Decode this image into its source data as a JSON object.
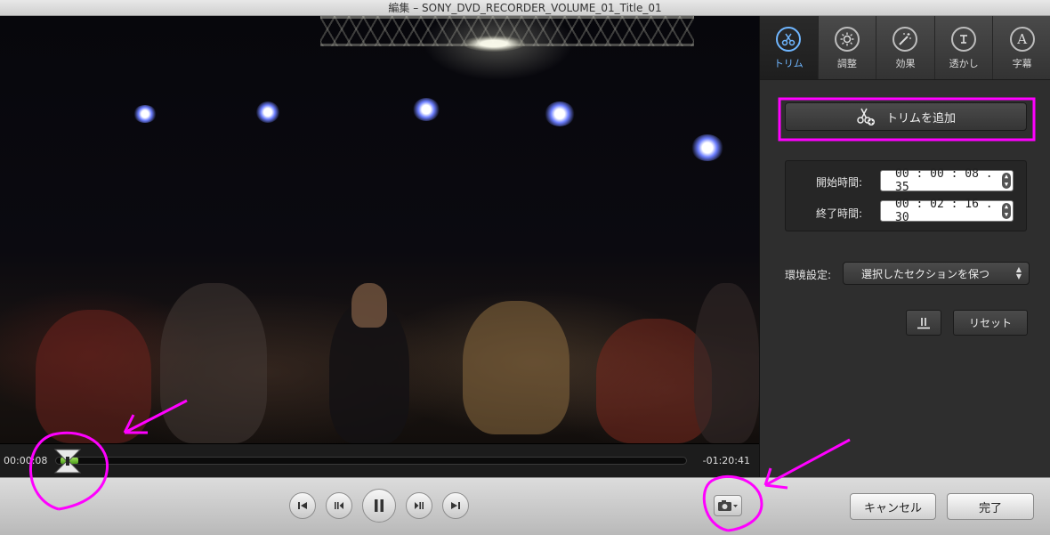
{
  "window": {
    "title": "編集 – SONY_DVD_RECORDER_VOLUME_01_Title_01"
  },
  "timeline": {
    "current_time": "00:00:08",
    "remaining_time": "-01:20:41"
  },
  "tabs": [
    {
      "label": "トリム",
      "icon": "scissors-icon",
      "active": true
    },
    {
      "label": "調整",
      "icon": "brightness-icon",
      "active": false
    },
    {
      "label": "効果",
      "icon": "magic-wand-icon",
      "active": false
    },
    {
      "label": "透かし",
      "icon": "watermark-icon",
      "active": false
    },
    {
      "label": "字幕",
      "icon": "subtitle-icon",
      "active": false
    }
  ],
  "trim": {
    "add_label": "トリムを追加",
    "start_label": "開始時間:",
    "start_value": "00 : 00 : 08 . 35",
    "end_label": "終了時間:",
    "end_value": "00 : 02 : 16 . 30"
  },
  "preferences": {
    "label": "環境設定:",
    "selected": "選択したセクションを保つ"
  },
  "buttons": {
    "reset": "リセット",
    "cancel": "キャンセル",
    "done": "完了"
  },
  "colors": {
    "accent": "#6fb6ff",
    "trim_bar": "#5fb52a",
    "annotation": "#ff00ff"
  }
}
